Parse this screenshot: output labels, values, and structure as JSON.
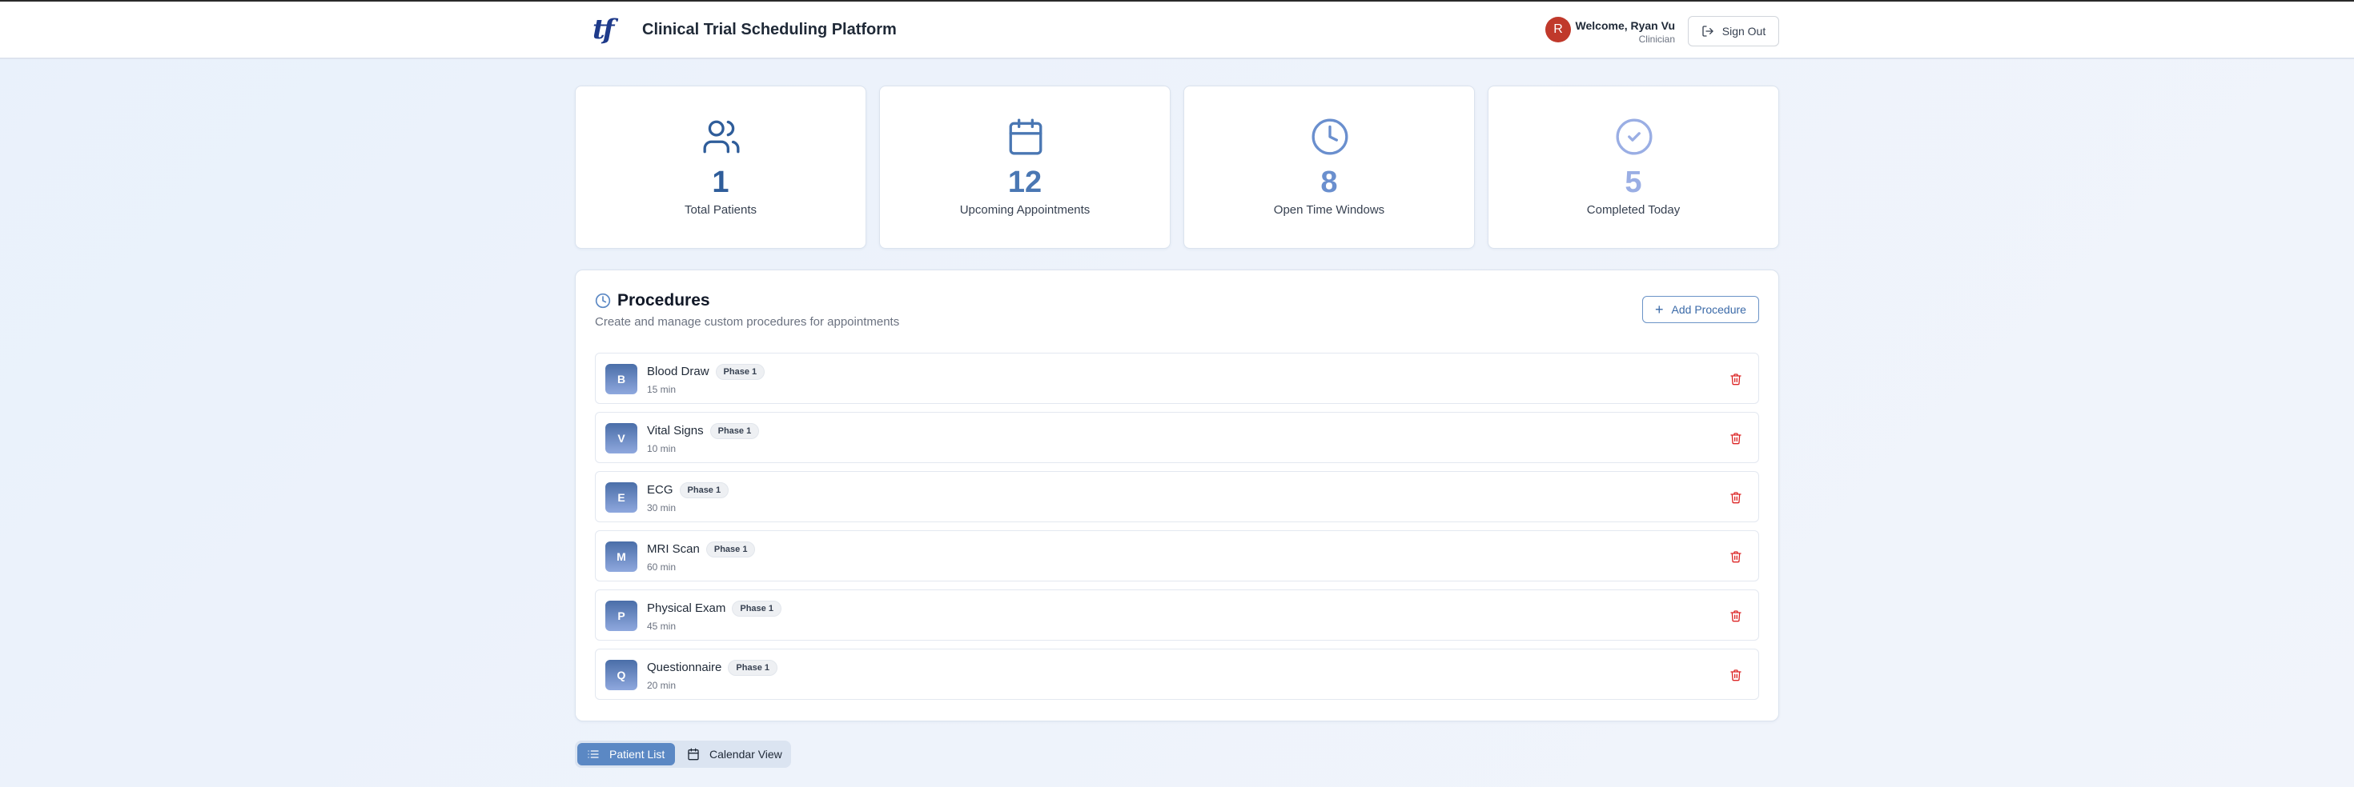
{
  "header": {
    "logo": "tf",
    "title": "Clinical Trial Scheduling Platform",
    "avatar_initial": "R",
    "welcome": "Welcome, Ryan Vu",
    "role": "Clinician",
    "signout_label": "Sign Out"
  },
  "stats": [
    {
      "value": "1",
      "label": "Total Patients",
      "icon": "users-icon",
      "color": "#2f5d9a"
    },
    {
      "value": "12",
      "label": "Upcoming Appointments",
      "icon": "calendar-icon",
      "color": "#4a77b3"
    },
    {
      "value": "8",
      "label": "Open Time Windows",
      "icon": "clock-icon",
      "color": "#6a8fce"
    },
    {
      "value": "5",
      "label": "Completed Today",
      "icon": "check-circle-icon",
      "color": "#9aaee4"
    }
  ],
  "procedures_panel": {
    "title": "Procedures",
    "subtitle": "Create and manage custom procedures for appointments",
    "add_label": "Add Procedure",
    "items": [
      {
        "initial": "B",
        "name": "Blood Draw",
        "phase": "Phase 1",
        "duration": "15 min"
      },
      {
        "initial": "V",
        "name": "Vital Signs",
        "phase": "Phase 1",
        "duration": "10 min"
      },
      {
        "initial": "E",
        "name": "ECG",
        "phase": "Phase 1",
        "duration": "30 min"
      },
      {
        "initial": "M",
        "name": "MRI Scan",
        "phase": "Phase 1",
        "duration": "60 min"
      },
      {
        "initial": "P",
        "name": "Physical Exam",
        "phase": "Phase 1",
        "duration": "45 min"
      },
      {
        "initial": "Q",
        "name": "Questionnaire",
        "phase": "Phase 1",
        "duration": "20 min"
      }
    ]
  },
  "view_toggle": {
    "patient_list": "Patient List",
    "calendar_view": "Calendar View",
    "active": "Patient List"
  },
  "colors": {
    "accent": "#5b88c4",
    "delete": "#dc2626"
  }
}
